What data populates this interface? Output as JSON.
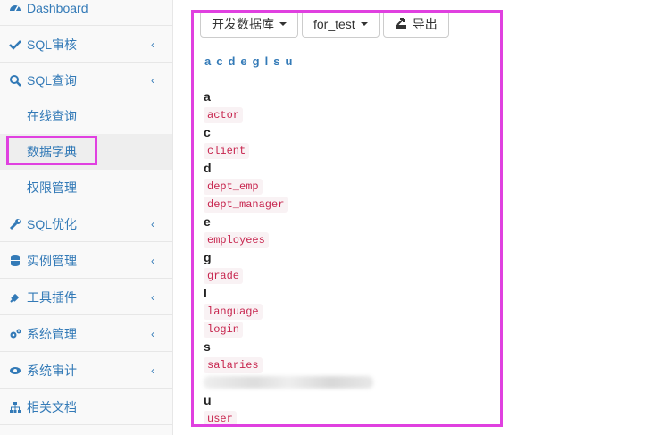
{
  "sidebar": {
    "items": [
      {
        "label": "Dashboard",
        "icon": "dashboard-icon"
      },
      {
        "label": "SQL审核",
        "icon": "check-icon"
      },
      {
        "label": "SQL查询",
        "icon": "search-icon"
      },
      {
        "label": "SQL优化",
        "icon": "wrench-icon"
      },
      {
        "label": "实例管理",
        "icon": "database-icon"
      },
      {
        "label": "工具插件",
        "icon": "plug-icon"
      },
      {
        "label": "系统管理",
        "icon": "cogs-icon"
      },
      {
        "label": "系统审计",
        "icon": "eye-icon"
      },
      {
        "label": "相关文档",
        "icon": "sitemap-icon"
      }
    ],
    "sub_items": [
      "在线查询",
      "数据字典",
      "权限管理"
    ],
    "chevron": "‹"
  },
  "toolbar": {
    "env_label": "开发数据库",
    "db_label": "for_test",
    "export_label": "导出"
  },
  "letters": [
    "a",
    "c",
    "d",
    "e",
    "g",
    "l",
    "s",
    "u"
  ],
  "groups": [
    {
      "letter": "a",
      "tables": [
        "actor"
      ]
    },
    {
      "letter": "c",
      "tables": [
        "client"
      ]
    },
    {
      "letter": "d",
      "tables": [
        "dept_emp",
        "dept_manager"
      ]
    },
    {
      "letter": "e",
      "tables": [
        "employees"
      ]
    },
    {
      "letter": "g",
      "tables": [
        "grade"
      ]
    },
    {
      "letter": "l",
      "tables": [
        "language",
        "login"
      ]
    },
    {
      "letter": "s",
      "tables": [
        "salaries"
      ]
    },
    {
      "letter": "u",
      "tables": [
        "user"
      ]
    }
  ],
  "colors": {
    "accent": "#337ab7",
    "highlight": "#e040e0",
    "code_text": "#c7254e",
    "code_bg": "#f9f2f4"
  }
}
